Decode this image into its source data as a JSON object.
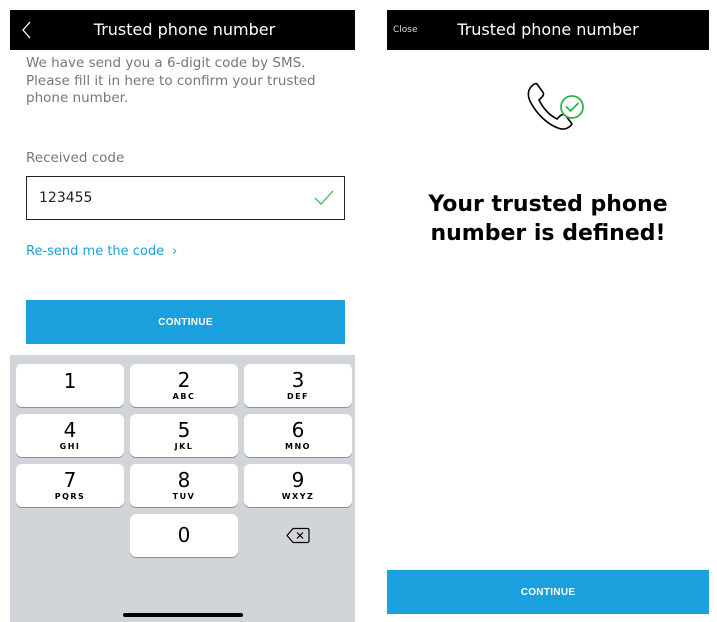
{
  "left_screen": {
    "header": {
      "title": "Trusted phone number",
      "back_icon": "chevron-left-icon"
    },
    "intro_text": "We have send you a 6-digit code by SMS. Please fill it in here to confirm your trusted phone number.",
    "code_field": {
      "label": "Received code",
      "value": "123455",
      "status_icon": "check-icon"
    },
    "resend_link": {
      "label": "Re-send me the code",
      "chevron": "›"
    },
    "continue_label": "CONTINUE",
    "keypad": {
      "keys": [
        {
          "digit": "1",
          "letters": ""
        },
        {
          "digit": "2",
          "letters": "ABC"
        },
        {
          "digit": "3",
          "letters": "DEF"
        },
        {
          "digit": "4",
          "letters": "GHI"
        },
        {
          "digit": "5",
          "letters": "JKL"
        },
        {
          "digit": "6",
          "letters": "MNO"
        },
        {
          "digit": "7",
          "letters": "PQRS"
        },
        {
          "digit": "8",
          "letters": "TUV"
        },
        {
          "digit": "9",
          "letters": "WXYZ"
        },
        {
          "digit": "0",
          "letters": ""
        }
      ],
      "delete_icon": "backspace-icon"
    }
  },
  "right_screen": {
    "header": {
      "close_label": "Close",
      "title": "Trusted phone number"
    },
    "success_icon": "phone-check-icon",
    "success_title": "Your trusted phone number is defined!",
    "continue_label": "CONTINUE"
  },
  "colors": {
    "accent": "#1aa0dd",
    "success": "#2fb34a",
    "navbar": "#000000",
    "keypad_bg": "#d1d4d9"
  }
}
